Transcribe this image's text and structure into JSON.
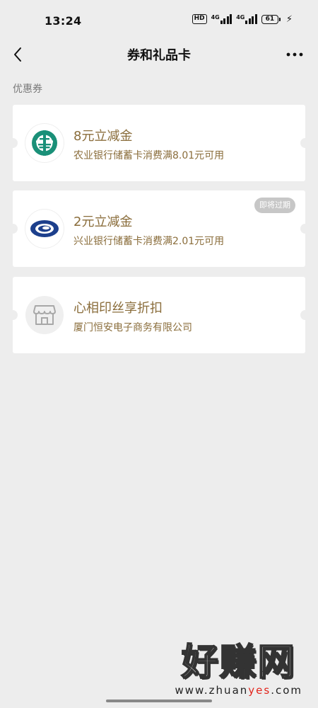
{
  "status_bar": {
    "time": "13:24",
    "hd": "HD",
    "net1": "4G",
    "net2": "4G",
    "battery": "61"
  },
  "nav": {
    "title": "券和礼品卡"
  },
  "section": {
    "title": "优惠券"
  },
  "coupons": [
    {
      "title": "8元立减金",
      "desc": "农业银行储蓄卡消费满8.01元可用",
      "logo": "abc-bank-logo-icon",
      "badge": ""
    },
    {
      "title": "2元立减金",
      "desc": "兴业银行储蓄卡消费满2.01元可用",
      "logo": "cib-bank-logo-icon",
      "badge": "即将过期"
    },
    {
      "title": "心相印丝享折扣",
      "desc": "厦门恒安电子商务有限公司",
      "logo": "store-icon",
      "badge": ""
    }
  ],
  "colors": {
    "background": "#ededed",
    "card": "#ffffff",
    "accent_text": "#8a6d3b",
    "abc_green": "#1a9078",
    "cib_blue": "#1c3f8c",
    "badge_gray": "#c7c7c7"
  },
  "watermark": {
    "main": "好赚网",
    "url_prefix": "www.zhuan",
    "url_highlight": "yes",
    "url_suffix": ".com"
  }
}
